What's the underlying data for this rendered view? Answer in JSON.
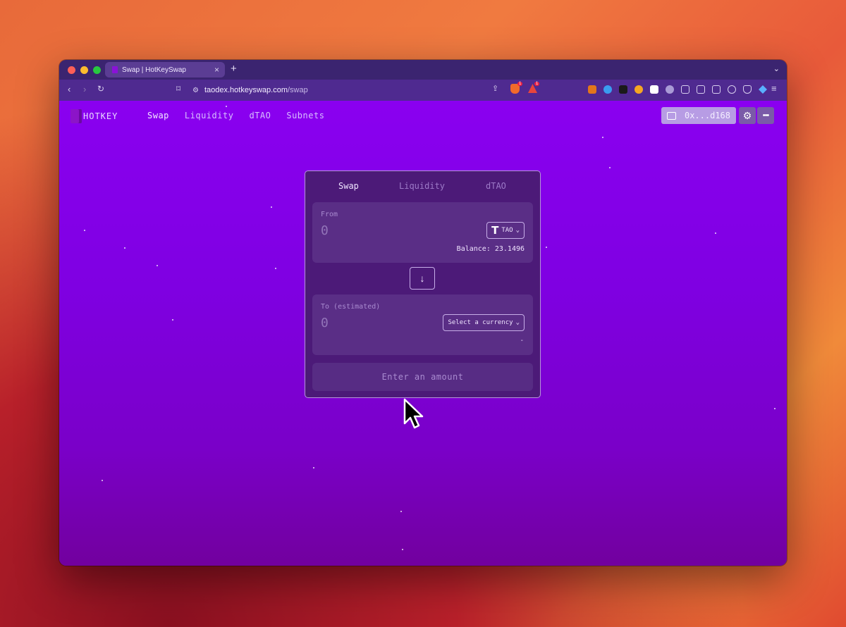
{
  "browser": {
    "tab_title": "Swap | HotKeySwap",
    "new_tab": "+",
    "url_host": "taodex.hotkeyswap.com",
    "url_path": "/swap",
    "ext_badge_1": "1",
    "ext_badge_2": "1"
  },
  "app": {
    "logo_text": "HOTKEY",
    "nav": [
      {
        "label": "Swap"
      },
      {
        "label": "Liquidity"
      },
      {
        "label": "dTAO"
      },
      {
        "label": "Subnets"
      }
    ],
    "wallet_address": "0x...d168",
    "settings_icon": "gear-icon",
    "more_icon": "ellipsis-icon"
  },
  "swap_card": {
    "tabs": [
      {
        "label": "Swap"
      },
      {
        "label": "Liquidity"
      },
      {
        "label": "dTAO"
      }
    ],
    "from": {
      "label": "From",
      "amount_placeholder": "0",
      "token_symbol": "T",
      "token": "TAO",
      "balance": "Balance: 23.1496"
    },
    "switch_icon": "arrow-down-icon",
    "to": {
      "label": "To (estimated)",
      "amount_placeholder": "0",
      "select_label": "Select a currency",
      "balance": "-"
    },
    "submit_label": "Enter an amount"
  },
  "colors": {
    "page_bg": "#8400f0",
    "card_bg": "#4c1a78",
    "panel_bg": "#5a2e86",
    "accent": "#c7aee8"
  }
}
